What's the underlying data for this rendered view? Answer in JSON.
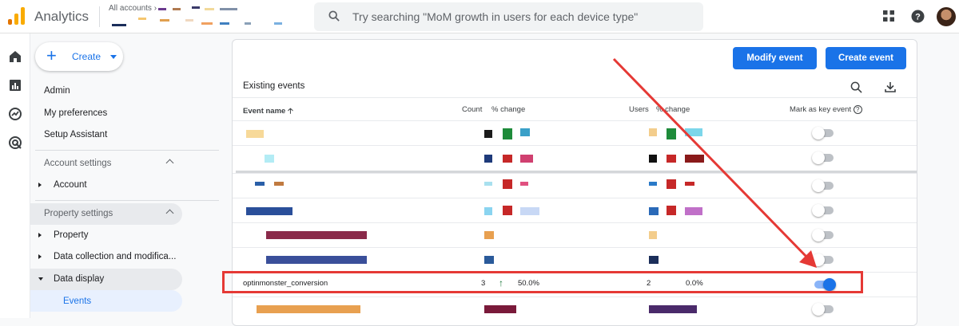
{
  "topbar": {
    "app_name": "Analytics",
    "accounts_label": "All accounts",
    "search_placeholder": "Try searching \"MoM growth in users for each device type\""
  },
  "icons": {
    "apps": "apps-grid-icon",
    "help": "help-icon",
    "search": "search-icon",
    "download": "download-icon"
  },
  "nav": {
    "create_label": "Create",
    "admin": "Admin",
    "my_preferences": "My preferences",
    "setup_assistant": "Setup Assistant",
    "account_settings": "Account settings",
    "account": "Account",
    "property_settings": "Property settings",
    "property": "Property",
    "data_collection": "Data collection and modifica...",
    "data_display": "Data display",
    "events": "Events"
  },
  "panel": {
    "modify_event": "Modify event",
    "create_event": "Create event",
    "title": "Existing events",
    "headers": {
      "event_name": "Event name",
      "count": "Count",
      "pct_change_1": "% change",
      "users": "Users",
      "pct_change_2": "% change",
      "mark_key_event": "Mark as key event"
    },
    "highlighted_row": {
      "name": "optinmonster_conversion",
      "count": "3",
      "count_change": "50.0%",
      "users": "2",
      "users_change": "0.0%",
      "key_event": true
    },
    "other_rows_key_event": [
      false,
      false,
      false,
      false,
      false,
      false,
      false
    ]
  },
  "colors": {
    "brand_blue": "#1a73e8",
    "annotation_red": "#e53935"
  }
}
